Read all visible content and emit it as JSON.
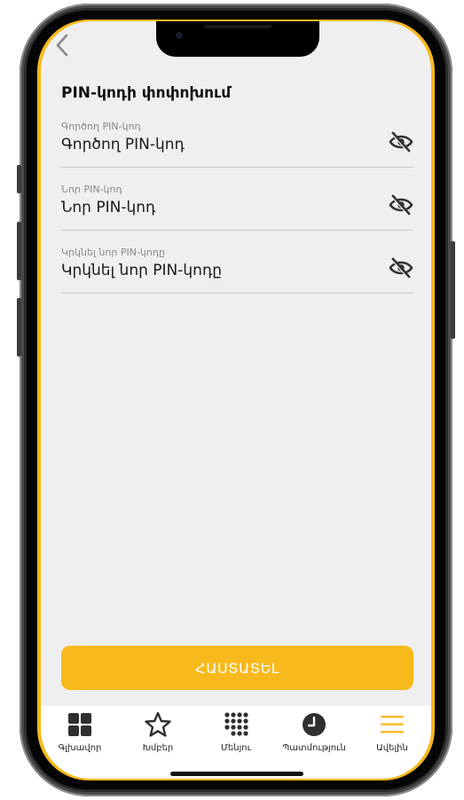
{
  "page": {
    "title": "PIN-կոդի փոփոխում"
  },
  "fields": [
    {
      "label": "Գործող PIN-կոդ",
      "value": "Գործող PIN-կոդ",
      "icon": "eye-off-icon"
    },
    {
      "label": "Նոր PIN-կոդ",
      "value": "Նոր PIN-կոդ",
      "icon": "eye-off-icon"
    },
    {
      "label": "Կրկնել նոր PIN-կոդը",
      "value": "Կրկնել նոր PIN-կոդը",
      "icon": "eye-off-icon"
    }
  ],
  "actions": {
    "save_label": "ՀԱՍՏԱՏԵԼ"
  },
  "tabbar": {
    "items": [
      {
        "label": "Գլխավոր",
        "icon": "grid-icon"
      },
      {
        "label": "Խմբեր",
        "icon": "star-icon"
      },
      {
        "label": "Մենյու",
        "icon": "dots-grid-icon"
      },
      {
        "label": "Պատմություն",
        "icon": "clock-icon"
      },
      {
        "label": "Ավելին",
        "icon": "hamburger-menu-icon"
      }
    ]
  },
  "colors": {
    "accent": "#f8b91c",
    "screen_background": "#efefef",
    "text": "#1a1a1a",
    "muted_text": "#8a8a8a"
  }
}
